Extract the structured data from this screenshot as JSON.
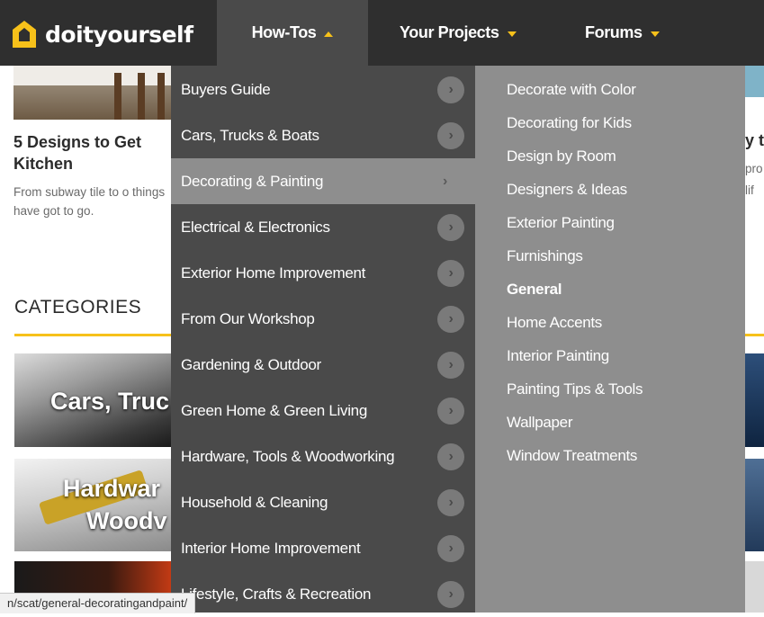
{
  "header": {
    "logo_text": "doityourself",
    "nav": [
      {
        "label": "How-Tos",
        "state": "open"
      },
      {
        "label": "Your Projects",
        "state": "closed"
      },
      {
        "label": "Forums",
        "state": "closed"
      }
    ],
    "accent_color": "#f7c11a"
  },
  "background": {
    "article_title": "5 Designs to Get Kitchen",
    "article_desc": "From subway tile to o things have got to go.",
    "right_title": "y t",
    "right_desc": "pro lif",
    "categories_heading": "CATEGORIES",
    "tiles": [
      {
        "line1": "Cars, Truc"
      },
      {
        "line1": "Hardwar",
        "line2": "Woodv"
      }
    ]
  },
  "menu": {
    "primary": [
      "Buyers Guide",
      "Cars, Trucks & Boats",
      "Decorating & Painting",
      "Electrical & Electronics",
      "Exterior Home Improvement",
      "From Our Workshop",
      "Gardening & Outdoor",
      "Green Home & Green Living",
      "Hardware, Tools & Woodworking",
      "Household & Cleaning",
      "Interior Home Improvement",
      "Lifestyle, Crafts & Recreation"
    ],
    "active_primary": "Decorating & Painting",
    "secondary": [
      "Decorate with Color",
      "Decorating for Kids",
      "Design by Room",
      "Designers & Ideas",
      "Exterior Painting",
      "Furnishings",
      "General",
      "Home Accents",
      "Interior Painting",
      "Painting Tips & Tools",
      "Wallpaper",
      "Window Treatments"
    ],
    "hovered_secondary": "General",
    "arrow_glyph": "›"
  },
  "statusbar": {
    "url": "n/scat/general-decoratingandpaint/"
  }
}
